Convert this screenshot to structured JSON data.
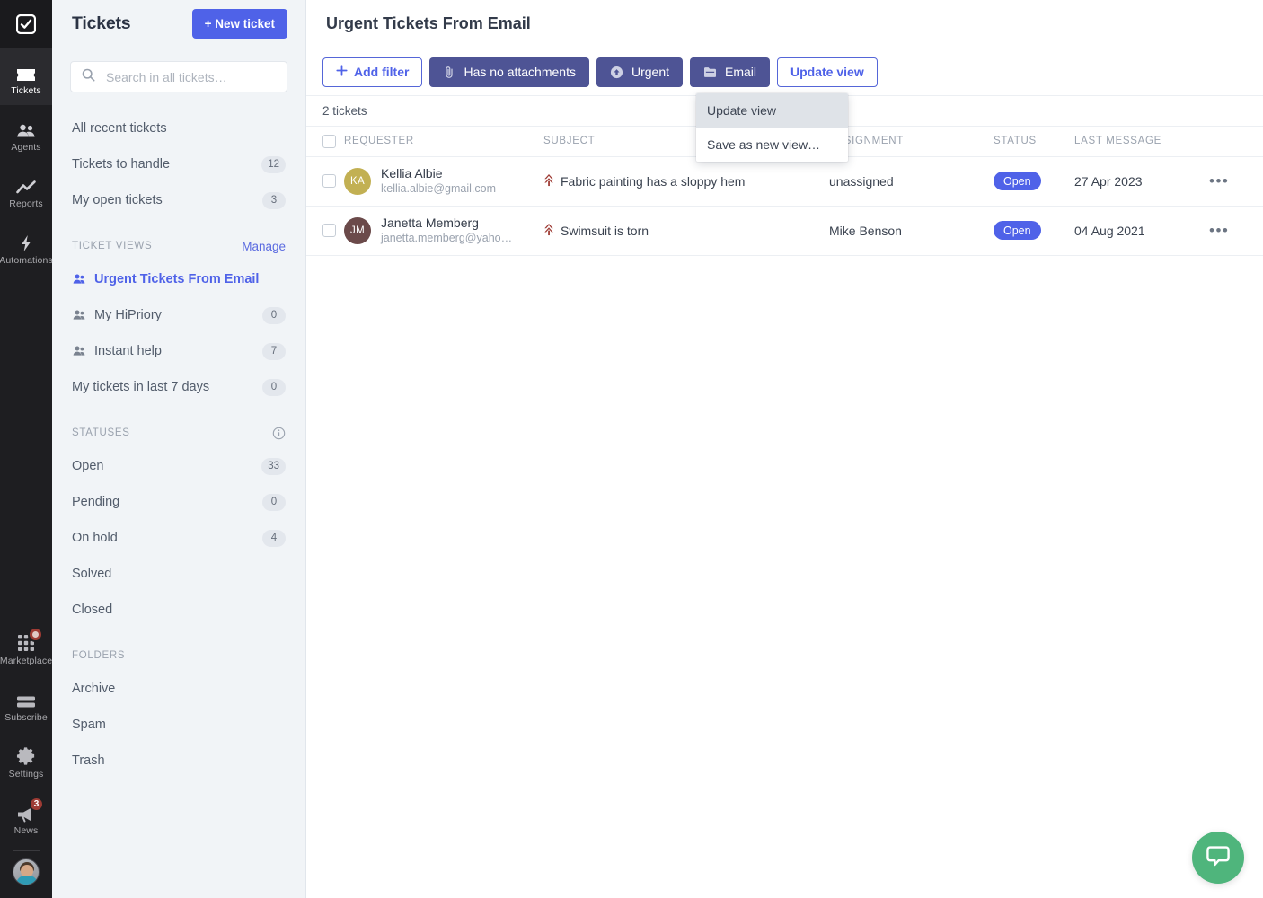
{
  "rail": {
    "logo_icon": "checkbox-logo-icon",
    "items": [
      {
        "label": "Tickets",
        "icon": "ticket-icon",
        "active": true
      },
      {
        "label": "Agents",
        "icon": "users-icon",
        "active": false
      },
      {
        "label": "Reports",
        "icon": "chart-line-icon",
        "active": false
      },
      {
        "label": "Automations",
        "icon": "bolt-icon",
        "active": false
      }
    ],
    "bottom_items": [
      {
        "label": "Marketplace",
        "icon": "grid-icon",
        "badge": ""
      },
      {
        "label": "Subscribe",
        "icon": "card-icon",
        "badge": ""
      },
      {
        "label": "Settings",
        "icon": "gear-icon",
        "badge": ""
      },
      {
        "label": "News",
        "icon": "megaphone-icon",
        "badge": "3"
      }
    ],
    "badge_color": "#9e3b34",
    "avatar": "user-avatar"
  },
  "sidebar": {
    "title": "Tickets",
    "new_ticket_label": "+ New ticket",
    "search": {
      "value": "",
      "placeholder": "Search in all tickets…",
      "icon": "search-icon"
    },
    "quick_links": [
      {
        "label": "All recent tickets",
        "count": ""
      },
      {
        "label": "Tickets to handle",
        "count": "12"
      },
      {
        "label": "My open tickets",
        "count": "3"
      }
    ],
    "views_section": {
      "title": "Ticket views",
      "action": "Manage"
    },
    "views": [
      {
        "label": "Urgent Tickets From Email",
        "count": "",
        "active": true,
        "icon": "view-people-icon"
      },
      {
        "label": "My HiPriory",
        "count": "0",
        "active": false,
        "icon": "view-people-icon"
      },
      {
        "label": "Instant help",
        "count": "7",
        "active": false,
        "icon": "view-people-icon"
      },
      {
        "label": "My tickets in last 7 days",
        "count": "0",
        "active": false,
        "icon": ""
      }
    ],
    "statuses_section": {
      "title": "Statuses",
      "info_icon": "info-icon"
    },
    "statuses": [
      {
        "label": "Open",
        "count": "33"
      },
      {
        "label": "Pending",
        "count": "0"
      },
      {
        "label": "On hold",
        "count": "4"
      },
      {
        "label": "Solved",
        "count": ""
      },
      {
        "label": "Closed",
        "count": ""
      }
    ],
    "folders_section": {
      "title": "Folders"
    },
    "folders": [
      {
        "label": "Archive",
        "count": ""
      },
      {
        "label": "Spam",
        "count": ""
      },
      {
        "label": "Trash",
        "count": ""
      }
    ]
  },
  "header": {
    "title": "Urgent Tickets From Email"
  },
  "toolbar": {
    "add_filter_label": "Add filter",
    "add_filter_icon": "plus-icon",
    "filters": [
      {
        "label": "Has no attachments",
        "icon": "paperclip-icon"
      },
      {
        "label": "Urgent",
        "icon": "arrow-up-circle-icon"
      },
      {
        "label": "Email",
        "icon": "folder-icon"
      }
    ],
    "update_view_label": "Update view",
    "filter_bg_color": "#4e5495",
    "accent_color": "#4f62e8"
  },
  "dropdown": {
    "open": true,
    "items": [
      {
        "label": "Update view",
        "highlighted": true
      },
      {
        "label": "Save as new view…",
        "highlighted": false
      }
    ]
  },
  "table": {
    "count_label": "2 tickets",
    "columns": [
      "Requester",
      "Subject",
      "Assignment",
      "Status",
      "Last message"
    ],
    "rows": [
      {
        "initials": "KA",
        "avatar_color": "#c2b053",
        "name": "Kellia Albie",
        "email": "kellia.albie@gmail.com",
        "priority_icon": "priority-high-icon",
        "subject": "Fabric painting has a sloppy hem",
        "assignment": "unassigned",
        "status": "Open",
        "status_color": "#4f62e8",
        "last_message": "27 Apr 2023",
        "actions_icon": "more-horizontal-icon"
      },
      {
        "initials": "JM",
        "avatar_color": "#6b4a4a",
        "name": "Janetta Memberg",
        "email": "janetta.memberg@yaho…",
        "priority_icon": "priority-high-icon",
        "subject": "Swimsuit is torn",
        "assignment": "Mike Benson",
        "status": "Open",
        "status_color": "#4f62e8",
        "last_message": "04 Aug 2021",
        "actions_icon": "more-horizontal-icon"
      }
    ]
  },
  "chat_widget": {
    "icon": "chat-bubble-icon",
    "color": "#4fb57c"
  }
}
